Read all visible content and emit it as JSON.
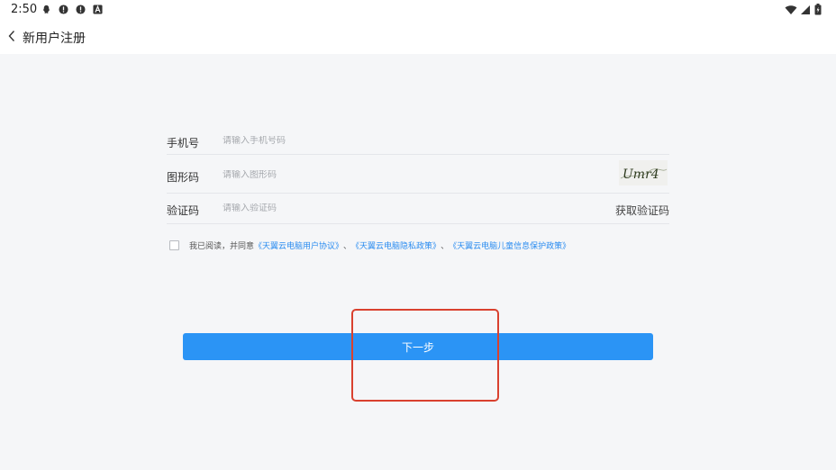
{
  "status_bar": {
    "time": "2:50",
    "left_icons": [
      "qq-icon",
      "alert-icon",
      "alert-icon",
      "font-a-icon"
    ],
    "right_icons": [
      "wifi-icon",
      "signal-icon",
      "battery-icon"
    ]
  },
  "app_bar": {
    "back_icon": "chevron-left-icon",
    "title": "新用户注册"
  },
  "form": {
    "phone": {
      "label": "手机号",
      "placeholder": "请输入手机号码",
      "value": ""
    },
    "captcha": {
      "label": "图形码",
      "placeholder": "请输入图形码",
      "value": "",
      "image_text": "Umr4"
    },
    "sms_code": {
      "label": "验证码",
      "placeholder": "请输入验证码",
      "value": "",
      "get_code_label": "获取验证码"
    }
  },
  "agreement": {
    "checked": false,
    "prefix": "我已阅读，并同意",
    "links": [
      "《天翼云电脑用户协议》",
      "《天翼云电脑隐私政策》",
      "《天翼云电脑儿童信息保护政策》"
    ],
    "separator": "、"
  },
  "next_button": {
    "label": "下一步"
  },
  "colors": {
    "primary": "#2b94f5",
    "link": "#2a8cf0",
    "background": "#f5f6f8",
    "highlight": "#d9412f"
  }
}
